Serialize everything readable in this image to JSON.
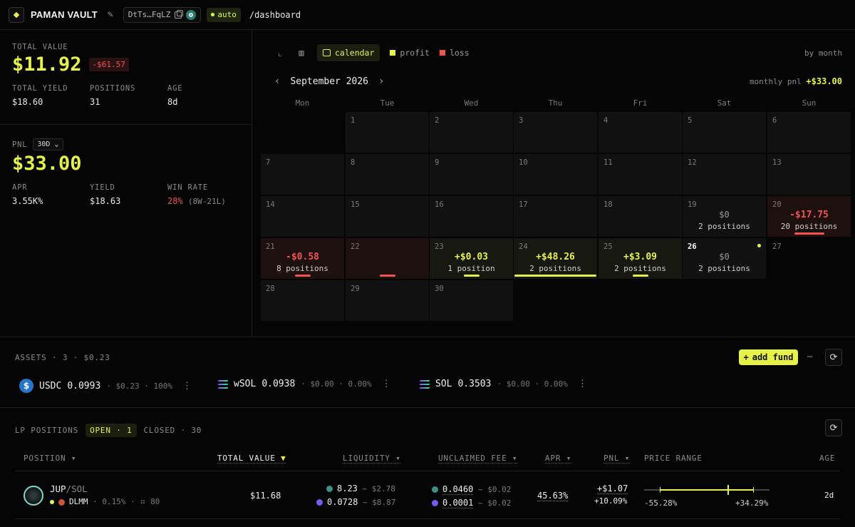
{
  "header": {
    "vault_name": "PAMAN VAULT",
    "address": "DtTs…FqLZ",
    "mode": "auto",
    "route": "/dashboard"
  },
  "summary": {
    "total_value_label": "TOTAL VALUE",
    "total_value": "$11.92",
    "total_value_change": "-$61.57",
    "stats": [
      {
        "label": "TOTAL YIELD",
        "value": "$18.60"
      },
      {
        "label": "POSITIONS",
        "value": "31"
      },
      {
        "label": "AGE",
        "value": "8d"
      }
    ]
  },
  "pnl": {
    "label": "PNL",
    "range": "30D",
    "value": "$33.00",
    "apr_label": "APR",
    "apr": "3.55K%",
    "yield_label": "YIELD",
    "yield": "$18.63",
    "win_rate_label": "WIN RATE",
    "win_rate": "28%",
    "win_rate_detail": "(8W-21L)"
  },
  "calendar": {
    "tab_label": "calendar",
    "legend_profit": "profit",
    "legend_loss": "loss",
    "view_mode": "by month",
    "month": "September 2026",
    "monthly_pnl_label": "monthly pnl",
    "monthly_pnl": "+$33.00",
    "weekdays": [
      "Mon",
      "Tue",
      "Wed",
      "Thu",
      "Fri",
      "Sat",
      "Sun"
    ],
    "days": [
      {
        "n": "1",
        "col": 1,
        "row": 0
      },
      {
        "n": "2",
        "col": 2,
        "row": 0
      },
      {
        "n": "3",
        "col": 3,
        "row": 0
      },
      {
        "n": "4",
        "col": 4,
        "row": 0
      },
      {
        "n": "5",
        "col": 5,
        "row": 0
      },
      {
        "n": "6",
        "col": 6,
        "row": 0
      },
      {
        "n": "7",
        "col": 0,
        "row": 1
      },
      {
        "n": "8",
        "col": 1,
        "row": 1
      },
      {
        "n": "9",
        "col": 2,
        "row": 1
      },
      {
        "n": "10",
        "col": 3,
        "row": 1
      },
      {
        "n": "11",
        "col": 4,
        "row": 1
      },
      {
        "n": "12",
        "col": 5,
        "row": 1
      },
      {
        "n": "13",
        "col": 6,
        "row": 1
      },
      {
        "n": "14",
        "col": 0,
        "row": 2
      },
      {
        "n": "15",
        "col": 1,
        "row": 2
      },
      {
        "n": "16",
        "col": 2,
        "row": 2
      },
      {
        "n": "17",
        "col": 3,
        "row": 2
      },
      {
        "n": "18",
        "col": 4,
        "row": 2
      },
      {
        "n": "19",
        "col": 5,
        "row": 2,
        "amount": "$0",
        "positions": "2 positions",
        "kind": "zero",
        "pnl": 0
      },
      {
        "n": "20",
        "col": 6,
        "row": 2,
        "amount": "-$17.75",
        "positions": "20 positions",
        "kind": "loss",
        "pnl": -17.75
      },
      {
        "n": "21",
        "col": 0,
        "row": 3,
        "amount": "-$0.58",
        "positions": "8 positions",
        "kind": "loss",
        "pnl": -0.58
      },
      {
        "n": "22",
        "col": 1,
        "row": 3,
        "kind": "loss",
        "pnl": -0.3
      },
      {
        "n": "23",
        "col": 2,
        "row": 3,
        "amount": "+$0.03",
        "positions": "1 position",
        "kind": "profit",
        "pnl": 0.03
      },
      {
        "n": "24",
        "col": 3,
        "row": 3,
        "amount": "+$48.26",
        "positions": "2 positions",
        "kind": "profit",
        "pnl": 48.26
      },
      {
        "n": "25",
        "col": 4,
        "row": 3,
        "amount": "+$3.09",
        "positions": "2 positions",
        "kind": "profit",
        "pnl": 3.09
      },
      {
        "n": "26",
        "col": 5,
        "row": 3,
        "amount": "$0",
        "positions": "2 positions",
        "kind": "zero",
        "today": true,
        "pnl": 0
      },
      {
        "n": "27",
        "col": 6,
        "row": 3,
        "future": true
      },
      {
        "n": "28",
        "col": 0,
        "row": 4
      },
      {
        "n": "29",
        "col": 1,
        "row": 4
      },
      {
        "n": "30",
        "col": 2,
        "row": 4
      }
    ]
  },
  "assets": {
    "label": "ASSETS",
    "count": "3",
    "total": "$0.23",
    "add_fund_label": "add fund",
    "items": [
      {
        "symbol": "USDC",
        "amount": "0.0993",
        "value": "$0.23",
        "share": "100%",
        "icon": "usdc-icon"
      },
      {
        "symbol": "wSOL",
        "amount": "0.0938",
        "value": "$0.00",
        "share": "0.00%",
        "icon": "sol-icon"
      },
      {
        "symbol": "SOL",
        "amount": "0.3503",
        "value": "$0.00",
        "share": "0.00%",
        "icon": "sol-icon"
      }
    ]
  },
  "lp": {
    "label": "LP POSITIONS",
    "open_label": "OPEN",
    "open_count": "1",
    "closed_label": "CLOSED",
    "closed_count": "30",
    "columns": {
      "position": "POSITION",
      "total_value": "TOTAL VALUE",
      "liquidity": "LIQUIDITY",
      "unclaimed_fee": "UNCLAIMED FEE",
      "apr": "APR",
      "pnl": "PNL",
      "price_range": "PRICE RANGE",
      "age": "AGE"
    },
    "rows": [
      {
        "base": "JUP",
        "quote": "/SOL",
        "type": "DLMM",
        "fee": "0.15%",
        "bin_step": "80",
        "total_value": "$11.68",
        "liq_a": "8.23",
        "liq_a_usd": "$2.78",
        "liq_b": "0.0728",
        "liq_b_usd": "$8.87",
        "fee_a": "0.0460",
        "fee_a_usd": "$0.02",
        "fee_b": "0.0001",
        "fee_b_usd": "$0.02",
        "apr": "45.63%",
        "pnl": "+$1.07",
        "pnl_pct": "+10.09%",
        "range_low": "-55.28%",
        "range_high": "+34.29%",
        "age": "2d"
      }
    ]
  },
  "colors": {
    "accent": "#e6f24a",
    "loss": "#f0544f",
    "bg": "#050505"
  }
}
